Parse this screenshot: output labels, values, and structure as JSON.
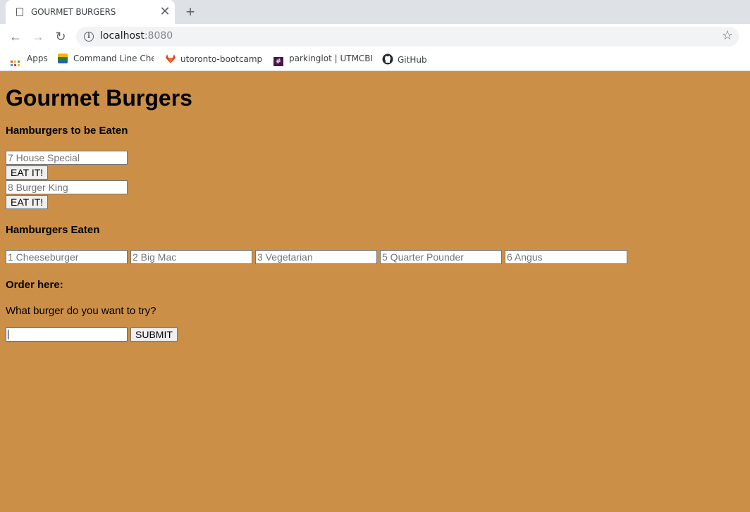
{
  "browser": {
    "tab_title": "GOURMET BURGERS",
    "close_glyph": "✕",
    "new_tab_glyph": "+",
    "url_host": "localhost",
    "url_port": ":8080",
    "back_glyph": "←",
    "forward_glyph": "→",
    "reload_glyph": "↻",
    "star_glyph": "☆",
    "bookmarks": [
      {
        "label": "Apps",
        "icon": "apps-grid-icon"
      },
      {
        "label": "Command Line Chea",
        "icon": "command-line-icon"
      },
      {
        "label": "utoronto-bootcamp",
        "icon": "gitlab-icon"
      },
      {
        "label": "parkinglot | UTMCBM",
        "icon": "slack-icon"
      },
      {
        "label": "GitHub",
        "icon": "github-icon"
      }
    ]
  },
  "page": {
    "title": "Gourmet Burgers",
    "to_eat_heading": "Hamburgers to be Eaten",
    "to_eat": [
      {
        "value": "7 House Special",
        "button": "EAT IT!"
      },
      {
        "value": "8 Burger King",
        "button": "EAT IT!"
      }
    ],
    "eaten_heading": "Hamburgers Eaten",
    "eaten": [
      "1 Cheeseburger",
      "2 Big Mac",
      "3 Vegetarian",
      "5 Quarter Pounder",
      "6 Angus"
    ],
    "order_heading": "Order here:",
    "order_prompt": "What burger do you want to try?",
    "order_input": "",
    "submit_label": "SUBMIT"
  },
  "colors": {
    "page_background": "#cb8f48",
    "tabstrip": "#dee1e6"
  }
}
